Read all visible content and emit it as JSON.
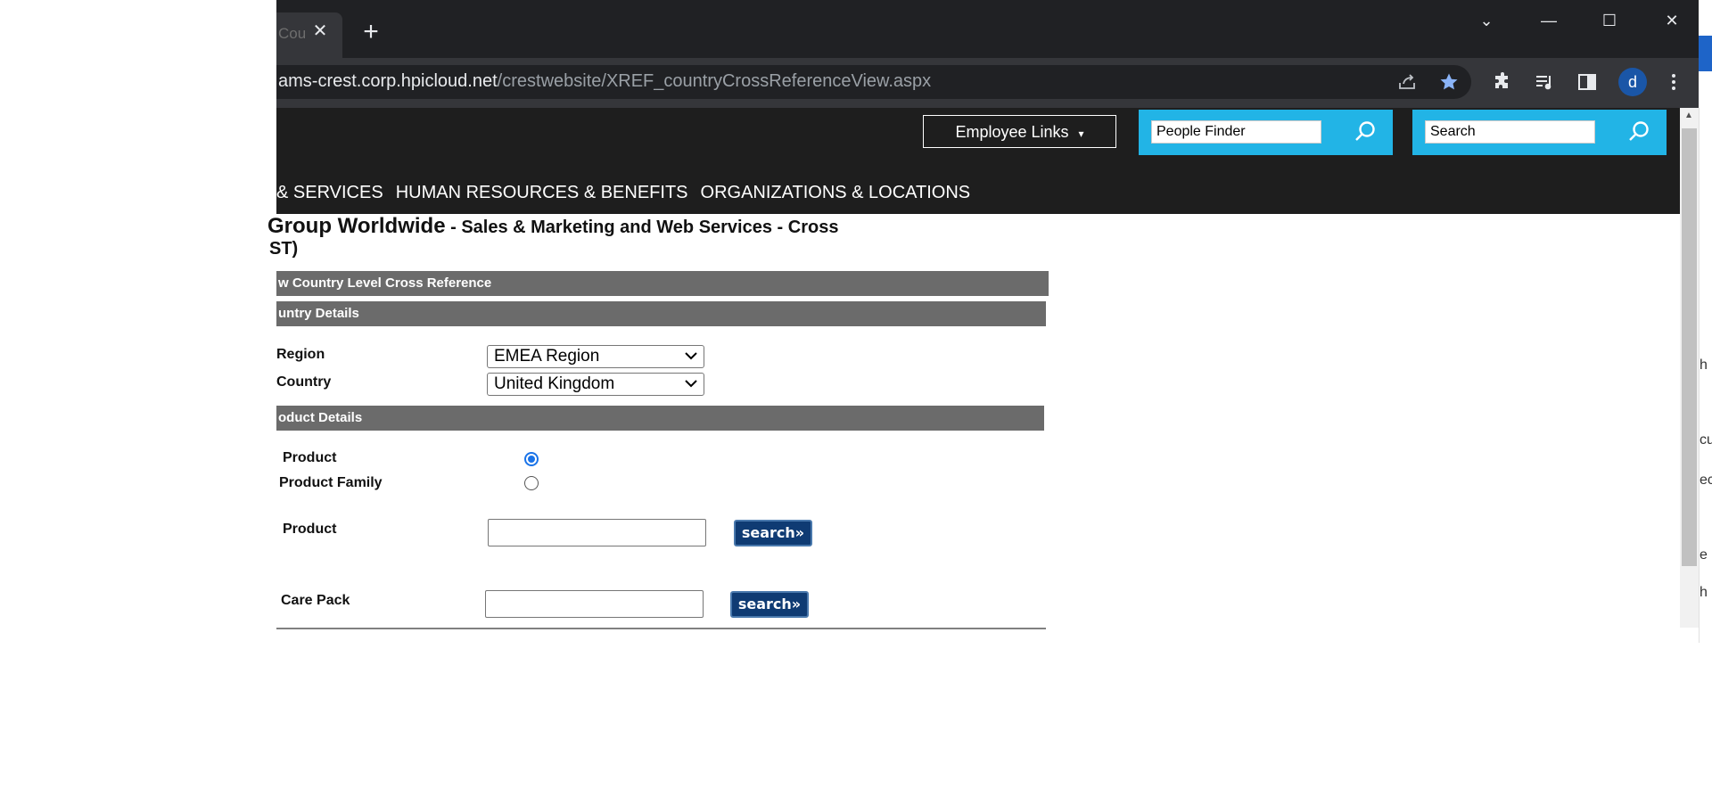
{
  "browser": {
    "tab_title": "Coun",
    "tab_close": "✕",
    "new_tab": "+",
    "url_host": "ams-crest.corp.hpicloud.net",
    "url_path": "/crestwebsite/XREF_countryCrossReferenceView.aspx",
    "profile_initial": "d",
    "window_controls": {
      "tab_search": "⌄",
      "minimize": "—",
      "maximize": "☐",
      "close": "✕"
    }
  },
  "header": {
    "employee_links": "Employee Links",
    "employee_links_caret": "▾",
    "people_finder_value": "People Finder",
    "search_value": "Search",
    "nav": [
      "& SERVICES",
      "HUMAN RESOURCES & BENEFITS",
      "ORGANIZATIONS & LOCATIONS"
    ]
  },
  "page": {
    "title_main": "Group Worldwide",
    "title_sub": " - Sales & Marketing and Web Services - Cross",
    "title_line2": "ST)",
    "section_view": "w Country Level Cross Reference",
    "section_country": "untry Details",
    "region_label": "Region",
    "region_value": "EMEA Region",
    "country_label": "Country",
    "country_value": "United Kingdom",
    "section_product": "oduct Details",
    "radio_product_label": "Product",
    "radio_family_label": "Product Family",
    "radio_selected": "Product",
    "product_label": "Product",
    "product_value": "",
    "carepack_label": "Care Pack",
    "carepack_value": "",
    "search_button": "search»",
    "search_button2": "search»"
  },
  "behind_window_fragments": [
    "h",
    "cu",
    "ec",
    "e",
    "h"
  ],
  "colors": {
    "header_bg": "#1e1e1e",
    "search_box_bg": "#22b4e6",
    "section_bar_bg": "#6b6b6b",
    "button_bg": "#0f3b73",
    "radio_accent": "#1a73e8"
  },
  "icons": [
    "share-icon",
    "star-icon",
    "extensions-icon",
    "media-icon",
    "side-panel-icon",
    "menu-icon",
    "magnifier-icon"
  ]
}
